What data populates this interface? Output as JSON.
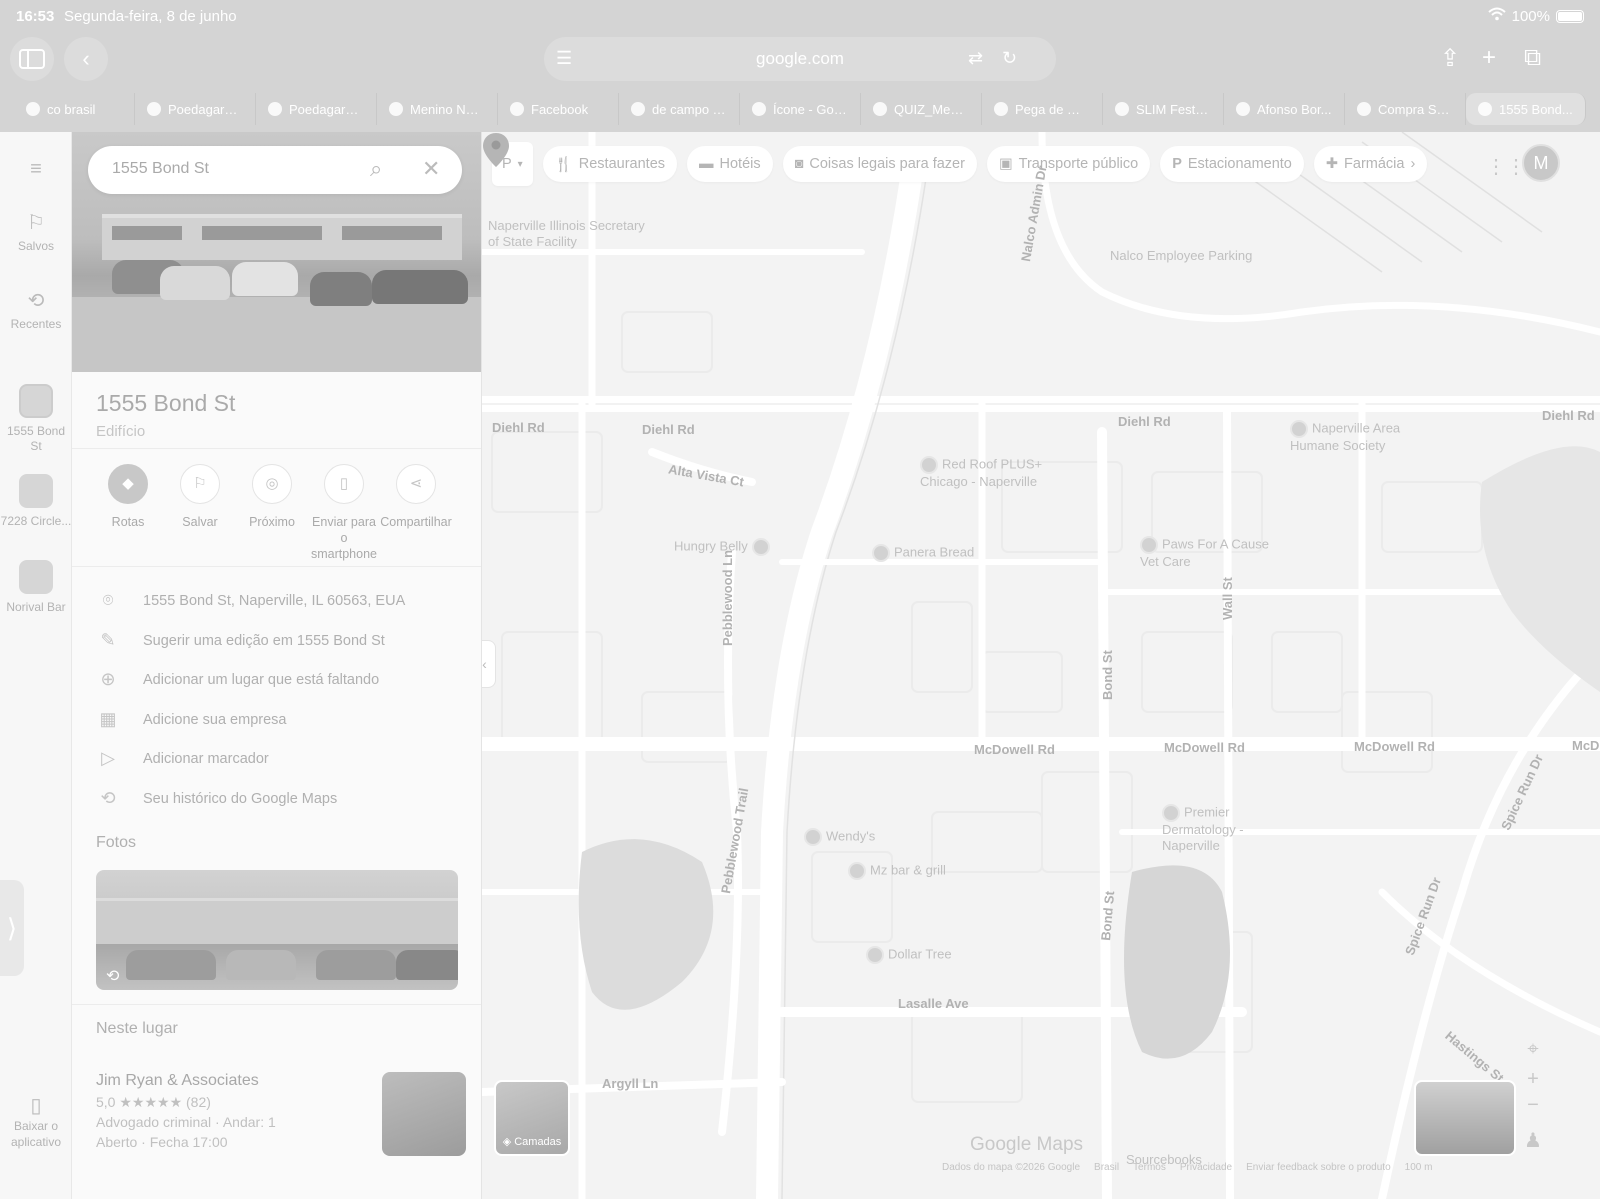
{
  "status_bar": {
    "time": "16:53",
    "date": "Segunda-feira, 8 de junho",
    "battery": "100%"
  },
  "browser": {
    "url": "google.com",
    "tabs": [
      {
        "label": "co brasil",
        "icon": "google-icon"
      },
      {
        "label": "Poedagar&...",
        "icon": "shield-icon"
      },
      {
        "label": "Poedagar&...",
        "icon": "shield-icon"
      },
      {
        "label": "Menino Ney...",
        "icon": "threads-icon"
      },
      {
        "label": "Facebook",
        "icon": "facebook-icon"
      },
      {
        "label": "de campo T...",
        "icon": "text-a-icon"
      },
      {
        "label": "Ícone - Goo...",
        "icon": "drive-icon"
      },
      {
        "label": "QUIZ_Mestr...",
        "icon": "drive-icon"
      },
      {
        "label": "Pega de Ou...",
        "icon": "drive-icon"
      },
      {
        "label": "SLIM Festa...",
        "icon": "doc-icon"
      },
      {
        "label": "Afonso Bor...",
        "icon": "x-icon"
      },
      {
        "label": "Compra Se...",
        "icon": "store-icon"
      },
      {
        "label": "1555 Bond...",
        "icon": "close-icon",
        "active": true
      }
    ]
  },
  "rail": {
    "saved": "Salvos",
    "recent": "Recentes",
    "recent_places": [
      {
        "label": "1555 Bond St"
      },
      {
        "label": "7228 Circle..."
      },
      {
        "label": "Norival Bar"
      }
    ],
    "download": "Baixar o aplicativo"
  },
  "search": {
    "value": "1555 Bond St"
  },
  "place": {
    "title": "1555 Bond St",
    "category": "Edifício",
    "actions": [
      {
        "label": "Rotas",
        "icon": "directions-icon"
      },
      {
        "label": "Salvar",
        "icon": "bookmark-icon"
      },
      {
        "label": "Próximo",
        "icon": "nearby-icon"
      },
      {
        "label": "Enviar para o smartphone",
        "icon": "send-to-phone-icon"
      },
      {
        "label": "Compartilhar",
        "icon": "share-icon"
      }
    ],
    "info": [
      {
        "text": "1555 Bond St, Naperville, IL 60563, EUA",
        "icon": "location-pin-icon"
      },
      {
        "text": "Sugerir uma edição em 1555 Bond St",
        "icon": "pencil-icon"
      },
      {
        "text": "Adicionar um lugar que está faltando",
        "icon": "add-place-icon"
      },
      {
        "text": "Adicione sua empresa",
        "icon": "add-business-icon"
      },
      {
        "text": "Adicionar marcador",
        "icon": "label-icon"
      },
      {
        "text": "Seu histórico do Google Maps",
        "icon": "history-icon"
      }
    ],
    "photos_heading": "Fotos",
    "here_heading": "Neste lugar",
    "business": {
      "name": "Jim Ryan & Associates",
      "rating": "5,0",
      "stars": "★★★★★",
      "reviews": "(82)",
      "category_line": "Advogado criminal · Andar: 1",
      "hours": "Aberto · Fecha 17:00"
    }
  },
  "map": {
    "categories": [
      {
        "label": "Restaurantes",
        "icon": "fork-knife-icon"
      },
      {
        "label": "Hotéis",
        "icon": "bed-icon"
      },
      {
        "label": "Coisas legais para fazer",
        "icon": "camera-icon"
      },
      {
        "label": "Transporte público",
        "icon": "bus-icon"
      },
      {
        "label": "Estacionamento",
        "icon": "parking-icon"
      },
      {
        "label": "Farmácia",
        "icon": "pharmacy-icon"
      }
    ],
    "avatar_letter": "M",
    "poi": [
      {
        "name": "Naperville Illinois Secretary of State Facility"
      },
      {
        "name": "Nalco Employee Parking"
      },
      {
        "name": "Naperville Area Humane Society"
      },
      {
        "name": "Red Roof PLUS+ Chicago - Naperville"
      },
      {
        "name": "Hungry Belly"
      },
      {
        "name": "Panera Bread"
      },
      {
        "name": "Paws For A Cause Vet Care"
      },
      {
        "name": "Premier Dermatology - Naperville"
      },
      {
        "name": "Wendy's"
      },
      {
        "name": "Mz bar & grill"
      },
      {
        "name": "Dollar Tree"
      },
      {
        "name": "Sourcebooks"
      }
    ],
    "roads": {
      "diehl_1": "Diehl Rd",
      "diehl_2": "Diehl Rd",
      "diehl_3": "Diehl Rd",
      "diehl_4": "Diehl Rd",
      "alta_vista": "Alta Vista Ct",
      "mcdowell_1": "McDowell Rd",
      "mcdowell_2": "McDowell Rd",
      "mcdowell_3": "McDowell Rd",
      "mcdowell_4": "McDc",
      "lasalle": "Lasalle Ave",
      "argyll": "Argyll Ln",
      "pebblewood_1": "Pebblewood Ln",
      "pebblewood_2": "Pebblewood Trail",
      "bond_1": "Bond St",
      "bond_2": "Bond St",
      "wall": "Wall St",
      "spice_run": "Spice Run Dr",
      "spice_run_2": "Spice Run Dr",
      "hastings": "Hastings St",
      "nalco": "Nalco Admin Dr"
    },
    "layers_label": "Camadas",
    "brand": "Google Maps",
    "footer": [
      "Dados do mapa ©2026 Google",
      "Brasil",
      "Termos",
      "Privacidade",
      "Enviar feedback sobre o produto",
      "100 m"
    ]
  }
}
